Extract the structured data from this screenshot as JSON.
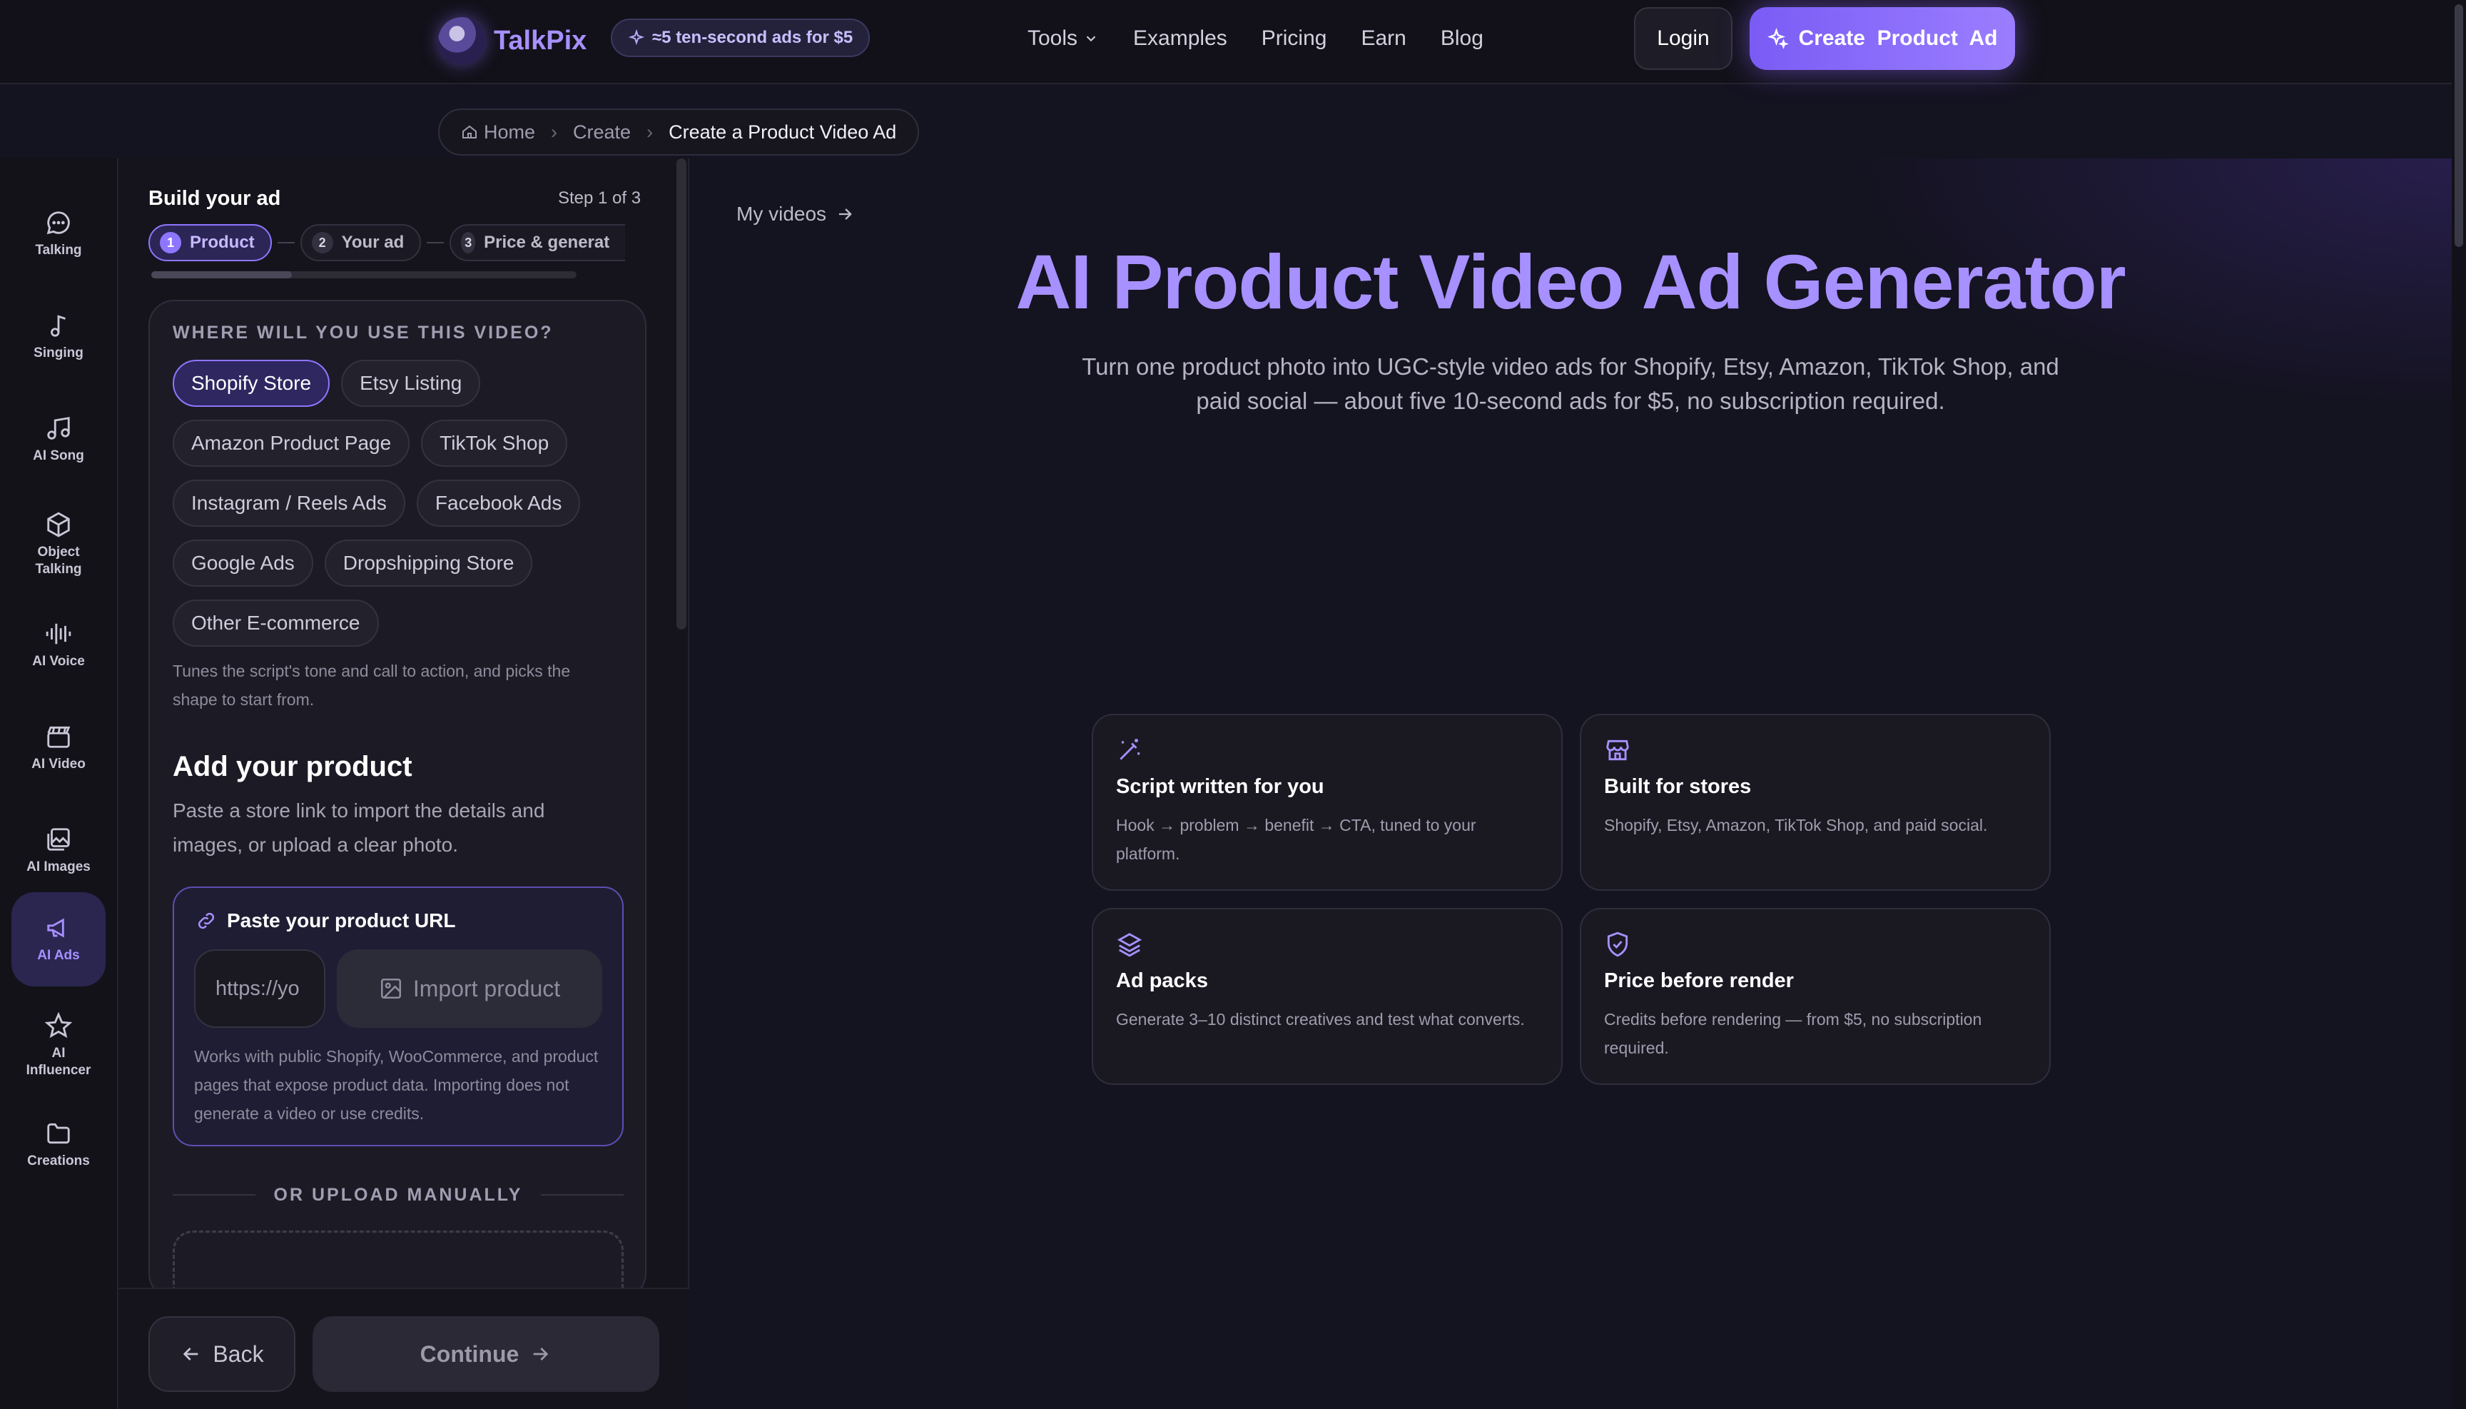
{
  "nav": {
    "brand": "TalkPix",
    "promo": "≈5 ten-second ads for $5",
    "links": [
      "Tools",
      "Examples",
      "Pricing",
      "Earn",
      "Blog"
    ],
    "login": "Login",
    "cta": "Create  Product  Ad",
    "accent": "#8f76ff"
  },
  "breadcrumb": {
    "home": "Home",
    "create": "Create",
    "current": "Create a Product Video Ad"
  },
  "rail": {
    "items": [
      {
        "label": "Talking",
        "icon": "chat-bubble-icon"
      },
      {
        "label": "Singing",
        "icon": "music-note-icon"
      },
      {
        "label": "AI Song",
        "icon": "music-notes-icon"
      },
      {
        "label": "Object Talking",
        "icon": "cube-icon"
      },
      {
        "label": "AI Voice",
        "icon": "waveform-icon"
      },
      {
        "label": "AI Video",
        "icon": "clapperboard-icon"
      },
      {
        "label": "AI Images",
        "icon": "images-icon"
      },
      {
        "label": "AI Ads",
        "icon": "megaphone-icon"
      },
      {
        "label": "AI Influencer",
        "icon": "star-icon"
      },
      {
        "label": "Creations",
        "icon": "folder-icon"
      }
    ],
    "active": "AI Ads"
  },
  "builder": {
    "title": "Build your ad",
    "step_count": "Step 1 of 3",
    "steps": [
      {
        "num": "1",
        "label": "Product"
      },
      {
        "num": "2",
        "label": "Your ad"
      },
      {
        "num": "3",
        "label": "Price & generat"
      }
    ],
    "progress": 0.33,
    "use_label": "WHERE WILL YOU USE THIS VIDEO?",
    "platforms": [
      "Shopify Store",
      "Etsy Listing",
      "Amazon Product Page",
      "TikTok Shop",
      "Instagram / Reels Ads",
      "Facebook Ads",
      "Google Ads",
      "Dropshipping Store",
      "Other E-commerce"
    ],
    "selected_platform": "Shopify Store",
    "platform_hint": "Tunes the script's tone and call to action, and picks the shape to start from.",
    "add_title": "Add your product",
    "add_sub": "Paste a store link to import the details and images, or upload a clear photo.",
    "url_title": "Paste your product URL",
    "url_placeholder": "https://yo",
    "import_label": "Import product",
    "url_note": "Works with public Shopify, WooCommerce, and product pages that expose product data. Importing does not generate a video or use credits.",
    "or_upload": "OR UPLOAD MANUALLY",
    "back": "Back",
    "continue": "Continue"
  },
  "main": {
    "my_videos": "My videos",
    "title": "AI Product Video Ad Generator",
    "subtitle": "Turn one product photo into UGC-style video ads for Shopify, Etsy, Amazon, TikTok Shop, and paid social — about five 10-second ads for $5, no subscription required.",
    "features": [
      {
        "title": "Script written for you",
        "body": "Hook → problem → benefit → CTA, tuned to your platform.",
        "icon": "magic-wand-icon"
      },
      {
        "title": "Built for stores",
        "body": "Shopify, Etsy, Amazon, TikTok Shop, and paid social.",
        "icon": "storefront-icon"
      },
      {
        "title": "Ad packs",
        "body": "Generate 3–10 distinct creatives and test what converts.",
        "icon": "layers-icon"
      },
      {
        "title": "Price before render",
        "body": "Credits before rendering — from $5, no subscription required.",
        "icon": "shield-check-icon"
      }
    ]
  }
}
